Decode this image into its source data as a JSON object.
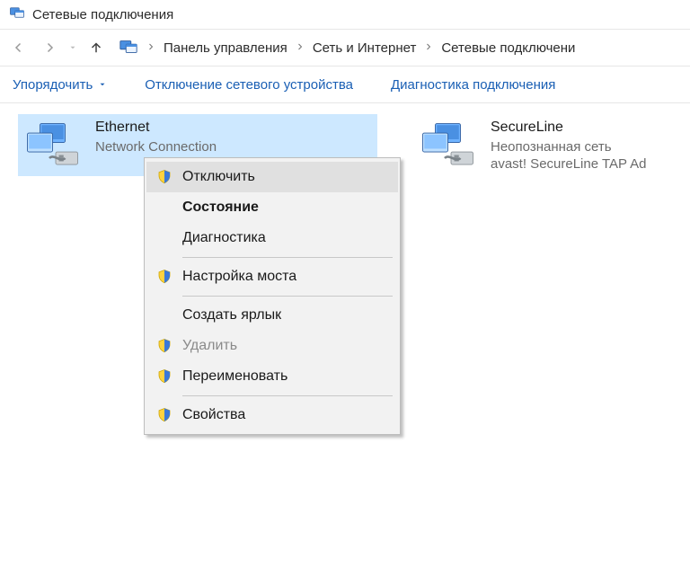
{
  "window": {
    "title": "Сетевые подключения"
  },
  "breadcrumb": {
    "items": [
      "Панель управления",
      "Сеть и Интернет",
      "Сетевые подключени"
    ]
  },
  "toolbar": {
    "organize": "Упорядочить",
    "disable_device": "Отключение сетевого устройства",
    "diagnose": "Диагностика подключения"
  },
  "connections": [
    {
      "name": "Ethernet",
      "line1": "Network Connection",
      "line2": ""
    },
    {
      "name": "SecureLine",
      "line1": "Неопознанная сеть",
      "line2": "avast! SecureLine TAP Ad"
    }
  ],
  "context_menu": {
    "items": [
      {
        "label": "Отключить",
        "shield": true,
        "disabled": false,
        "bold": false
      },
      {
        "label": "Состояние",
        "shield": false,
        "disabled": false,
        "bold": true
      },
      {
        "label": "Диагностика",
        "shield": false,
        "disabled": false,
        "bold": false
      },
      {
        "sep": true
      },
      {
        "label": "Настройка моста",
        "shield": true,
        "disabled": false,
        "bold": false
      },
      {
        "sep": true
      },
      {
        "label": "Создать ярлык",
        "shield": false,
        "disabled": false,
        "bold": false
      },
      {
        "label": "Удалить",
        "shield": true,
        "disabled": true,
        "bold": false
      },
      {
        "label": "Переименовать",
        "shield": true,
        "disabled": false,
        "bold": false
      },
      {
        "sep": true
      },
      {
        "label": "Свойства",
        "shield": true,
        "disabled": false,
        "bold": false
      }
    ]
  }
}
